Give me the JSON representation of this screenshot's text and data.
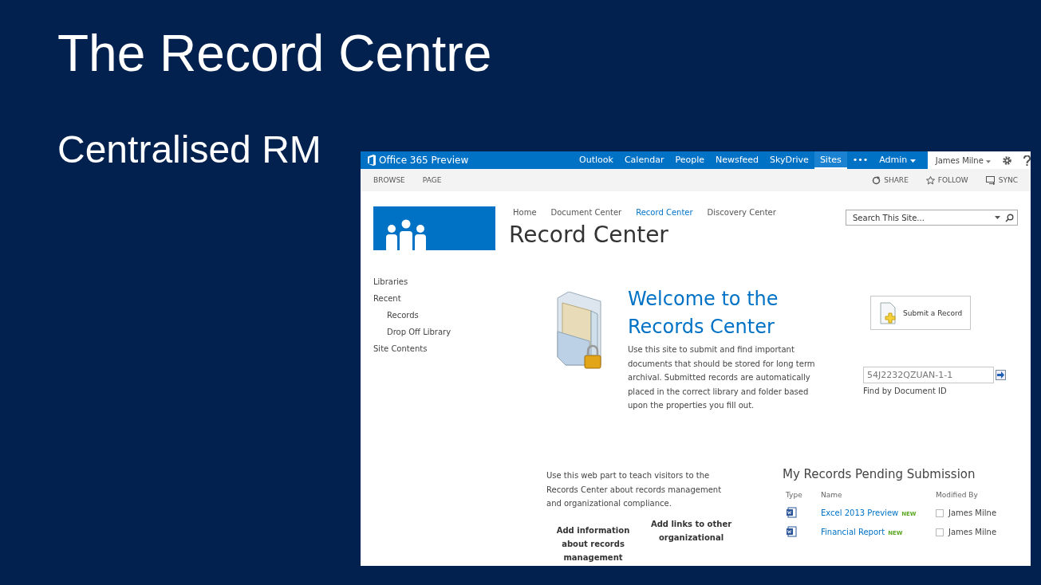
{
  "slide": {
    "title": "The Record Centre",
    "subtitle": "Centralised RM"
  },
  "suite_bar": {
    "brand": "Office 365 Preview",
    "links": [
      {
        "label": "Outlook",
        "selected": false
      },
      {
        "label": "Calendar",
        "selected": false
      },
      {
        "label": "People",
        "selected": false
      },
      {
        "label": "Newsfeed",
        "selected": false
      },
      {
        "label": "SkyDrive",
        "selected": false
      },
      {
        "label": "Sites",
        "selected": true
      }
    ],
    "more": "•••",
    "admin": "Admin",
    "user": "James Milne"
  },
  "ribbon": {
    "tabs": [
      "BROWSE",
      "PAGE"
    ],
    "actions": [
      {
        "kind": "share",
        "label": "SHARE"
      },
      {
        "kind": "follow",
        "label": "FOLLOW"
      },
      {
        "kind": "sync",
        "label": "SYNC"
      }
    ]
  },
  "site_nav": [
    {
      "label": "Home",
      "selected": false
    },
    {
      "label": "Document Center",
      "selected": false
    },
    {
      "label": "Record Center",
      "selected": true
    },
    {
      "label": "Discovery Center",
      "selected": false
    }
  ],
  "site_title": "Record Center",
  "search": {
    "placeholder": "Search This Site..."
  },
  "quick_launch": [
    {
      "label": "Libraries"
    },
    {
      "label": "Recent",
      "children": [
        {
          "label": "Records"
        },
        {
          "label": "Drop Off Library"
        }
      ]
    },
    {
      "label": "Site Contents"
    }
  ],
  "welcome": {
    "heading": "Welcome to the Records Center",
    "text": "Use this site to submit and find important documents that should be stored for long term archival. Submitted records are automatically placed in the correct library and folder based upon the properties you fill out."
  },
  "submit_button": "Submit a Record",
  "document_id": {
    "value": "54J2232QZUAN-1-1",
    "label": "Find by Document ID"
  },
  "teach": {
    "text": "Use this web part to teach visitors to the Records Center about records management and organizational compliance.",
    "columns": [
      "Add information about records management",
      "Add links to other organizational"
    ]
  },
  "pending": {
    "title": "My Records Pending Submission",
    "columns": [
      "Type",
      "Name",
      "Modified By"
    ],
    "rows": [
      {
        "name": "Excel 2013 Preview",
        "badge": "NEW",
        "modified_by": "James Milne",
        "checked": false
      },
      {
        "name": "Financial Report",
        "badge": "NEW",
        "modified_by": "James Milne",
        "checked": false
      }
    ]
  }
}
